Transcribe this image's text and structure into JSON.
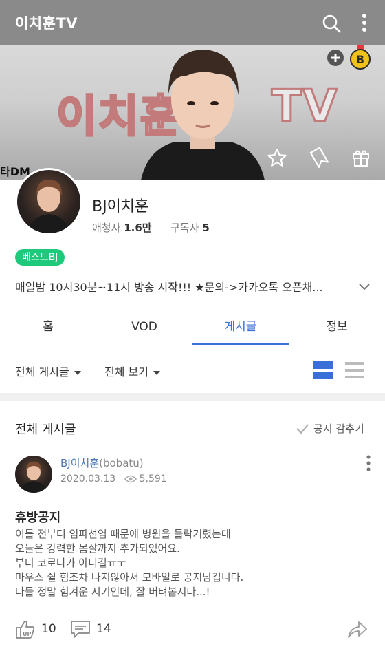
{
  "header": {
    "title": "이치훈TV"
  },
  "banner": {
    "watermark_left": "이치훈",
    "watermark_right": "TV",
    "corner_text": "타DM"
  },
  "profile": {
    "name": "BJ이치훈",
    "viewers_label": "애청자",
    "viewers_value": "1.6만",
    "subscribers_label": "구독자",
    "subscribers_value": "5",
    "badge": "베스트BJ",
    "description": "매일밤 10시30분~11시 방송 시작!!! ★문의->카카오톡 오픈채..."
  },
  "tabs": [
    {
      "label": "홈",
      "active": false
    },
    {
      "label": "VOD",
      "active": false
    },
    {
      "label": "게시글",
      "active": true
    },
    {
      "label": "정보",
      "active": false
    }
  ],
  "filters": {
    "board": "전체 게시글",
    "view": "전체 보기"
  },
  "section": {
    "title": "전체 게시글",
    "notice_toggle": "공지 감추기"
  },
  "post": {
    "author_name": "BJ이치훈",
    "author_id": "(bobatu)",
    "date": "2020.03.13",
    "views": "5,591",
    "title": "휴방공지",
    "body_lines": [
      "이틀 전부터 임파선염 때문에 병원을 들락거렸는데",
      "오늘은 강력한 몸살까지 추가되었어요.",
      "부디 코로나가 아니길ㅠㅜ",
      "마우스 쥘 힘조차 나지않아서 모바일로 공지남깁니다.",
      "다들 정말 힘겨운 시기인데, 잘 버텨봅시다...!"
    ],
    "likes": "10",
    "comments": "14"
  },
  "colors": {
    "topbar": "#8a8a8a",
    "accent": "#3a6fd8",
    "badge": "#1ec97b",
    "author_link": "#4a78b5"
  },
  "icons": [
    "search-icon",
    "more-vertical-icon",
    "plus-circle-icon",
    "b-medal-icon",
    "star-icon",
    "bookmark-icon",
    "gift-icon",
    "chevron-down-icon",
    "grid-view-icon",
    "list-view-icon",
    "check-icon",
    "eye-icon",
    "thumbs-up-icon",
    "comment-icon",
    "share-icon"
  ]
}
